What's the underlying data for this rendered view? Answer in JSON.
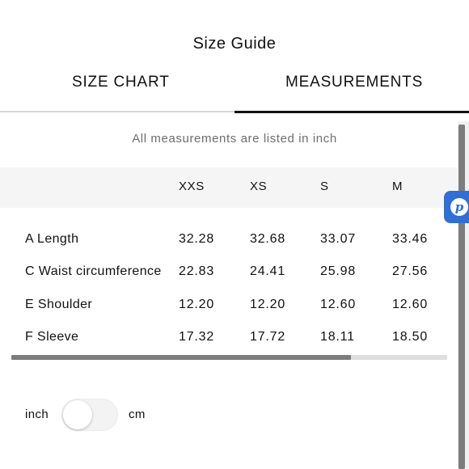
{
  "header": {
    "title": "Size Guide"
  },
  "tabs": [
    {
      "label": "SIZE CHART",
      "active": false
    },
    {
      "label": "MEASUREMENTS",
      "active": true
    }
  ],
  "note": "All measurements are listed in inch",
  "table": {
    "sizes": [
      "XXS",
      "XS",
      "S",
      "M"
    ],
    "rows": [
      {
        "label": "A Length",
        "values": [
          "32.28",
          "32.68",
          "33.07",
          "33.46"
        ]
      },
      {
        "label": "C Waist circumference",
        "values": [
          "22.83",
          "24.41",
          "25.98",
          "27.56"
        ]
      },
      {
        "label": "E Shoulder",
        "values": [
          "12.20",
          "12.20",
          "12.60",
          "12.60"
        ]
      },
      {
        "label": "F Sleeve",
        "values": [
          "17.32",
          "17.72",
          "18.11",
          "18.50"
        ]
      }
    ]
  },
  "unit_toggle": {
    "left_label": "inch",
    "right_label": "cm",
    "selected": "inch"
  },
  "side_badge": {
    "glyph": "p",
    "icon": "p-logo-icon",
    "color": "#2f6fd6"
  },
  "colors": {
    "accent": "#111111",
    "header_band": "#f5f5f5",
    "scrollbar_thumb": "#7d7d7d"
  }
}
